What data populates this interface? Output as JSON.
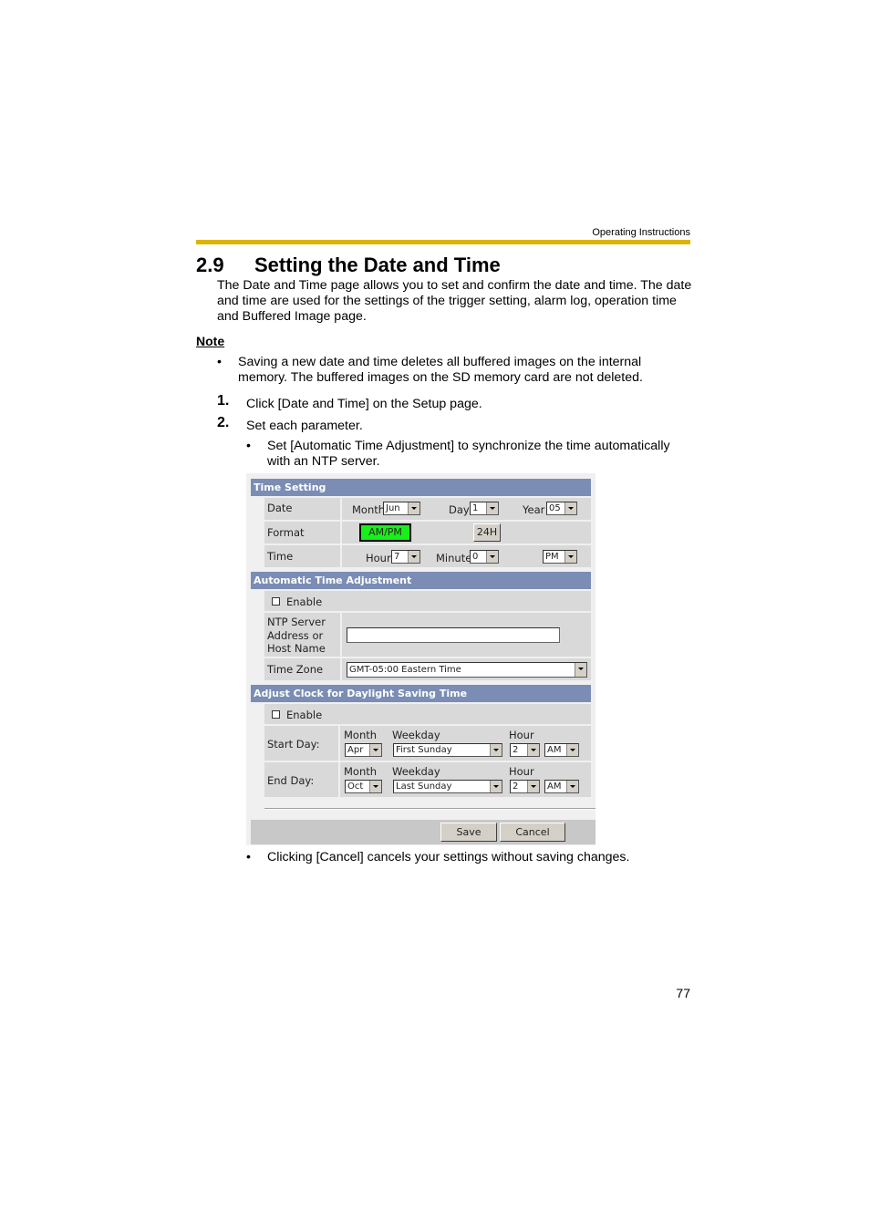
{
  "header": {
    "running_head": "Operating Instructions",
    "accent_color": "#dcb400"
  },
  "section": {
    "number": "2.9",
    "title": "Setting the Date and Time"
  },
  "intro": "The Date and Time page allows you to set and confirm the date and time. The date and time are used for the settings of the trigger setting, alarm log, operation time and Buffered Image page.",
  "note": {
    "heading": "Note",
    "bullets": [
      "Saving a new date and time deletes all buffered images on the internal memory. The buffered images on the SD memory card are not deleted."
    ]
  },
  "steps": [
    {
      "n": "1.",
      "text": "Click [Date and Time] on the Setup page."
    },
    {
      "n": "2.",
      "text": "Set each parameter."
    }
  ],
  "step2_bullets": [
    "Set [Automatic Time Adjustment] to synchronize the time automatically with an NTP server.",
    "Clicking [Cancel] cancels your settings without saving changes."
  ],
  "screenshot": {
    "header_color": "#7b8db5",
    "time_setting": {
      "title": "Time Setting",
      "date_label": "Date",
      "month_label": "Month",
      "month_value": "Jun",
      "day_label": "Day",
      "day_value": "1",
      "year_label": "Year",
      "year_value": "05",
      "format_label": "Format",
      "ampm_label": "AM/PM",
      "ampm_active_color": "#19f019",
      "h24_label": "24H",
      "time_label": "Time",
      "hour_label": "Hour",
      "hour_value": "7",
      "minute_label": "Minute",
      "minute_value": "0",
      "period_value": "PM"
    },
    "auto_adjust": {
      "title": "Automatic Time Adjustment",
      "enable_label": "Enable",
      "enabled": false,
      "ntp_label_1": "NTP Server",
      "ntp_label_2": "Address or",
      "ntp_label_3": "Host Name",
      "ntp_value": "",
      "tz_label": "Time Zone",
      "tz_value": "GMT-05:00 Eastern Time"
    },
    "dst": {
      "title": "Adjust Clock for Daylight Saving Time",
      "enable_label": "Enable",
      "enabled": false,
      "month_header": "Month",
      "weekday_header": "Weekday",
      "hour_header": "Hour",
      "start_label": "Start Day:",
      "start_month": "Apr",
      "start_weekday": "First Sunday",
      "start_hour": "2",
      "start_period": "AM",
      "end_label": "End Day:",
      "end_month": "Oct",
      "end_weekday": "Last Sunday",
      "end_hour": "2",
      "end_period": "AM"
    },
    "save_label": "Save",
    "cancel_label": "Cancel"
  },
  "page_number": "77"
}
